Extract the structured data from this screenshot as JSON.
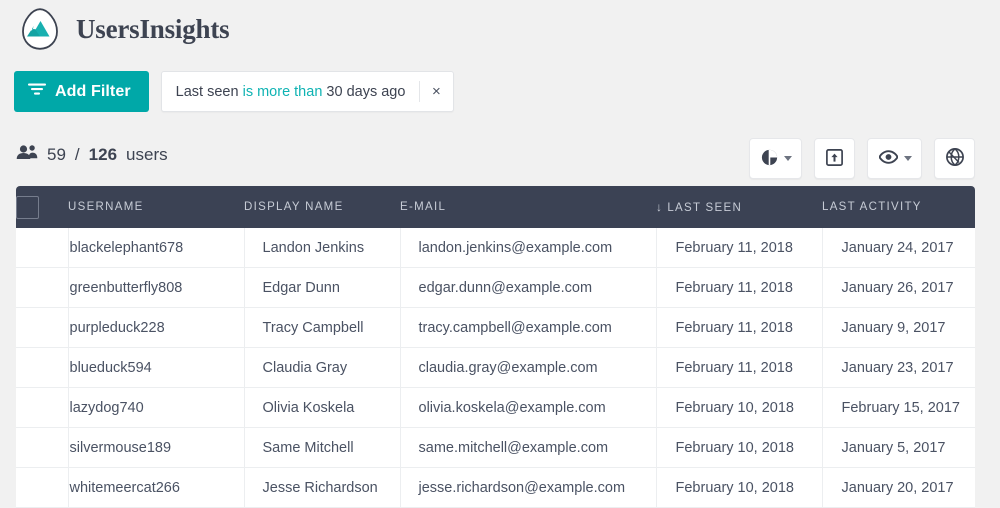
{
  "brand": {
    "name": "UsersInsights",
    "logo_icon": "mountain-logo-icon"
  },
  "filter_bar": {
    "add_filter_label": "Add Filter",
    "add_filter_icon": "funnel-icon",
    "chip": {
      "field": "Last seen",
      "operator": "is more than",
      "value": "30 days ago",
      "close_icon": "×"
    }
  },
  "stats": {
    "users_icon": "users-icon",
    "shown": "59",
    "separator": "/",
    "total": "126",
    "label": "users"
  },
  "toolbar": {
    "buttons": [
      {
        "name": "charts-button",
        "icon": "pie-chart-icon",
        "has_caret": true
      },
      {
        "name": "export-button",
        "icon": "export-box-icon",
        "has_caret": false
      },
      {
        "name": "visible-columns-button",
        "icon": "eye-icon",
        "has_caret": true
      },
      {
        "name": "map-button",
        "icon": "globe-icon",
        "has_caret": false
      }
    ]
  },
  "table": {
    "select_all_checkbox": "select-all-checkbox",
    "sort_indicator": "↓",
    "columns": [
      {
        "key": "username",
        "label": "USERNAME"
      },
      {
        "key": "display_name",
        "label": "DISPLAY NAME"
      },
      {
        "key": "email",
        "label": "E-MAIL"
      },
      {
        "key": "last_seen",
        "label": "LAST SEEN",
        "sorted": true
      },
      {
        "key": "last_activity",
        "label": "LAST ACTIVITY"
      }
    ],
    "rows": [
      {
        "username": "blackelephant678",
        "display_name": "Landon Jenkins",
        "email": "landon.jenkins@example.com",
        "last_seen": "February 11, 2018",
        "last_activity": "January 24, 2017",
        "avatar_colors": [
          "#6f7f8c",
          "#3e4a55",
          "#9aa7b0"
        ]
      },
      {
        "username": "greenbutterfly808",
        "display_name": "Edgar Dunn",
        "email": "edgar.dunn@example.com",
        "last_seen": "February 11, 2018",
        "last_activity": "January 26, 2017",
        "avatar_colors": [
          "#8a4a32",
          "#2d3a4a",
          "#c07a52"
        ]
      },
      {
        "username": "purpleduck228",
        "display_name": "Tracy Campbell",
        "email": "tracy.campbell@example.com",
        "last_seen": "February 11, 2018",
        "last_activity": "January 9, 2017",
        "avatar_colors": [
          "#c9c2bb",
          "#3a3334",
          "#8d7f78"
        ]
      },
      {
        "username": "blueduck594",
        "display_name": "Claudia Gray",
        "email": "claudia.gray@example.com",
        "last_seen": "February 11, 2018",
        "last_activity": "January 23, 2017",
        "avatar_colors": [
          "#7c6a5e",
          "#34282a",
          "#b9a18e"
        ]
      },
      {
        "username": "lazydog740",
        "display_name": "Olivia Koskela",
        "email": "olivia.koskela@example.com",
        "last_seen": "February 10, 2018",
        "last_activity": "February 15, 2017",
        "avatar_colors": [
          "#d9d2cb",
          "#4b3b34",
          "#a9968a"
        ]
      },
      {
        "username": "silvermouse189",
        "display_name": "Same Mitchell",
        "email": "same.mitchell@example.com",
        "last_seen": "February 10, 2018",
        "last_activity": "January 5, 2017",
        "avatar_colors": [
          "#8fa6b5",
          "#4a5a64",
          "#c3cdd4"
        ]
      },
      {
        "username": "whitemeercat266",
        "display_name": "Jesse Richardson",
        "email": "jesse.richardson@example.com",
        "last_seen": "February 10, 2018",
        "last_activity": "January 20, 2017",
        "avatar_colors": [
          "#5d4a3c",
          "#241c18",
          "#9a7d66"
        ]
      }
    ]
  },
  "colors": {
    "accent_teal": "#00a8a8",
    "chip_operator_teal": "#0fb3b3",
    "table_header_bg": "#3b4254",
    "page_bg": "#f1f1f1"
  }
}
